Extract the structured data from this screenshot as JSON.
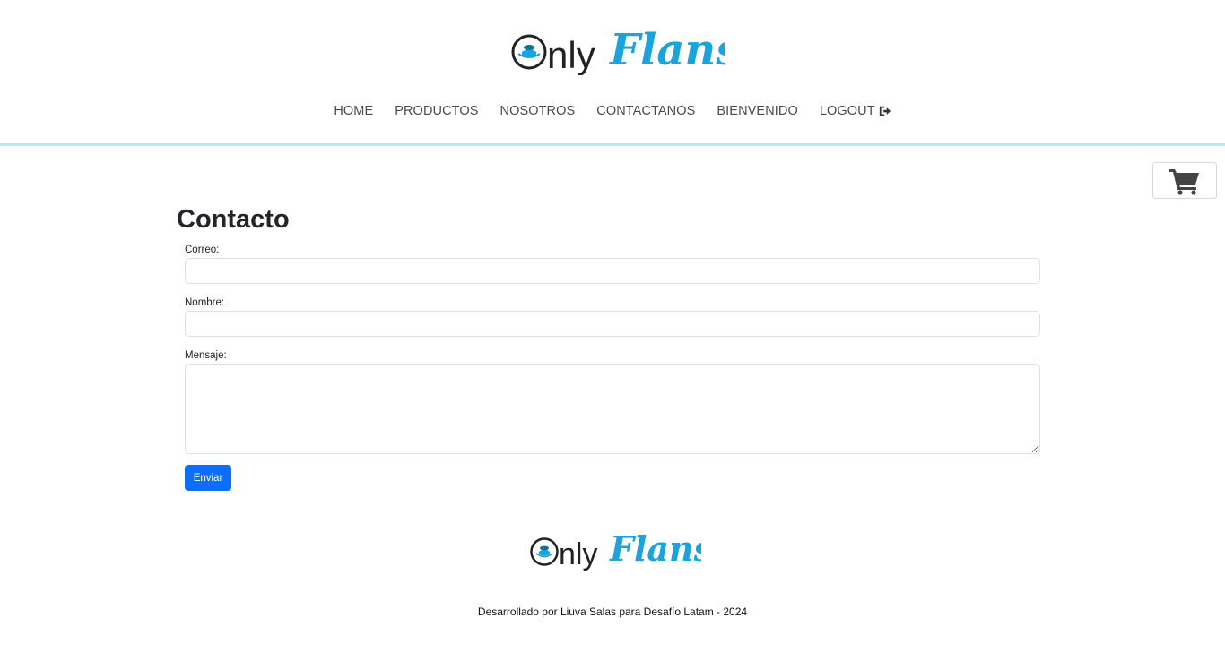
{
  "brand": {
    "name_part1": "nly",
    "name_part2": "Flans",
    "primary_color": "#1aa3dc",
    "dark_color": "#222222"
  },
  "nav": {
    "items": [
      {
        "label": "HOME"
      },
      {
        "label": "PRODUCTOS"
      },
      {
        "label": "NOSOTROS"
      },
      {
        "label": "CONTACTANOS"
      },
      {
        "label": "BIENVENIDO"
      },
      {
        "label": "LOGOUT",
        "icon": "sign-out-icon"
      }
    ]
  },
  "cart": {
    "icon": "shopping-cart-icon"
  },
  "form": {
    "title": "Contacto",
    "email_label": "Correo:",
    "email_value": "",
    "name_label": "Nombre:",
    "name_value": "",
    "message_label": "Mensaje:",
    "message_value": "",
    "submit_label": "Enviar",
    "submit_color": "#0d6efd"
  },
  "footer": {
    "text": "Desarrollado por Liuva Salas para Desafío Latam - 2024"
  }
}
